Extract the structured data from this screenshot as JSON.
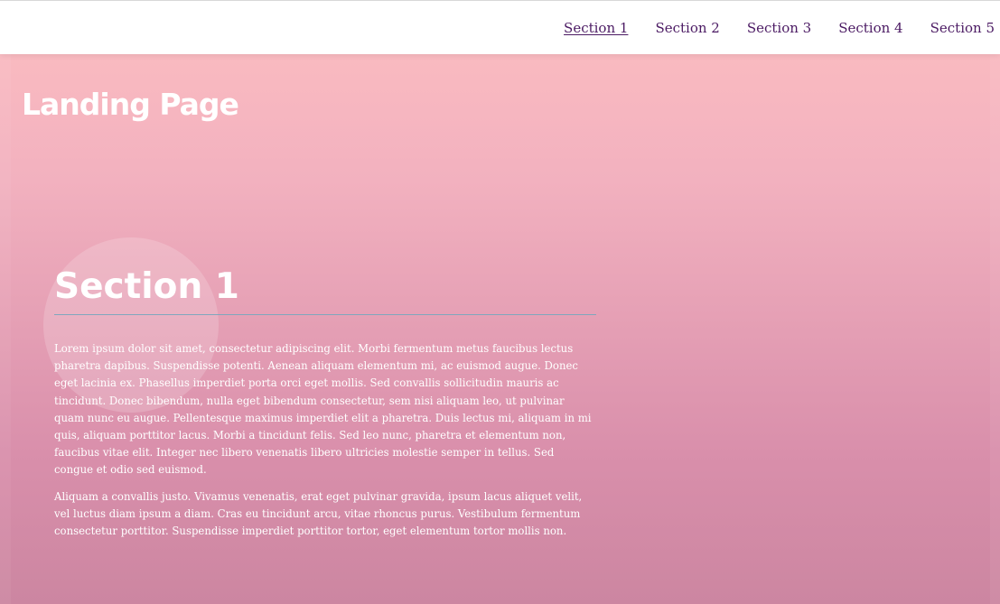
{
  "nav": {
    "items": [
      {
        "label": "Section 1",
        "active": true
      },
      {
        "label": "Section 2",
        "active": false
      },
      {
        "label": "Section 3",
        "active": false
      },
      {
        "label": "Section 4",
        "active": false
      },
      {
        "label": "Section 5",
        "active": false
      }
    ]
  },
  "header": {
    "title": "Landing Page"
  },
  "section1": {
    "title": "Section 1",
    "paragraphs": [
      "Lorem ipsum dolor sit amet, consectetur adipiscing elit. Morbi fermentum metus faucibus lectus pharetra dapibus. Suspendisse potenti. Aenean aliquam elementum mi, ac euismod augue. Donec eget lacinia ex. Phasellus imperdiet porta orci eget mollis. Sed convallis sollicitudin mauris ac tincidunt. Donec bibendum, nulla eget bibendum consectetur, sem nisi aliquam leo, ut pulvinar quam nunc eu augue. Pellentesque maximus imperdiet elit a pharetra. Duis lectus mi, aliquam in mi quis, aliquam porttitor lacus. Morbi a tincidunt felis. Sed leo nunc, pharetra et elementum non, faucibus vitae elit. Integer nec libero venenatis libero ultricies molestie semper in tellus. Sed congue et odio sed euismod.",
      "Aliquam a convallis justo. Vivamus venenatis, erat eget pulvinar gravida, ipsum lacus aliquet velit, vel luctus diam ipsum a diam. Cras eu tincidunt arcu, vitae rhoncus purus. Vestibulum fermentum consectetur porttitor. Suspendisse imperdiet porttitor tortor, eget elementum tortor mollis non."
    ]
  },
  "colors": {
    "nav_link": "#4b1a63",
    "nav_background": "#ffffff",
    "gradient_top": "#fdbec1",
    "gradient_bottom": "#cc86a1",
    "section_rule": "#7fa7bd",
    "text": "#ffffff"
  }
}
